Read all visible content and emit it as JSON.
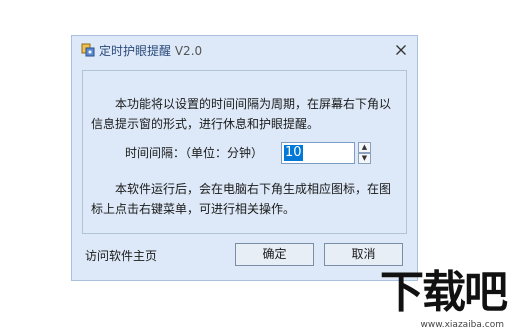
{
  "dialog": {
    "title": "定时护眼提醒",
    "version": "V2.0",
    "icon": "app-icon",
    "close_label": "X",
    "description": "本功能将以设置的时间间隔为周期，在屏幕右下角以信息提示窗的形式，进行休息和护眼提醒。",
    "interval_label": "时间间隔：（单位：分钟）",
    "interval_value": "10",
    "spin_up_icon": "▲",
    "spin_down_icon": "▼",
    "note": "本软件运行后，会在电脑右下角生成相应图标，在图标上点击右键菜单，可进行相关操作。",
    "home_link": "访问软件主页",
    "ok_label": "确定",
    "cancel_label": "取消"
  },
  "watermark": {
    "text": "下载吧",
    "url": "www.xiazaiba.com"
  },
  "colors": {
    "dialog_bg": "#dde9f8",
    "selection": "#0078d7"
  }
}
